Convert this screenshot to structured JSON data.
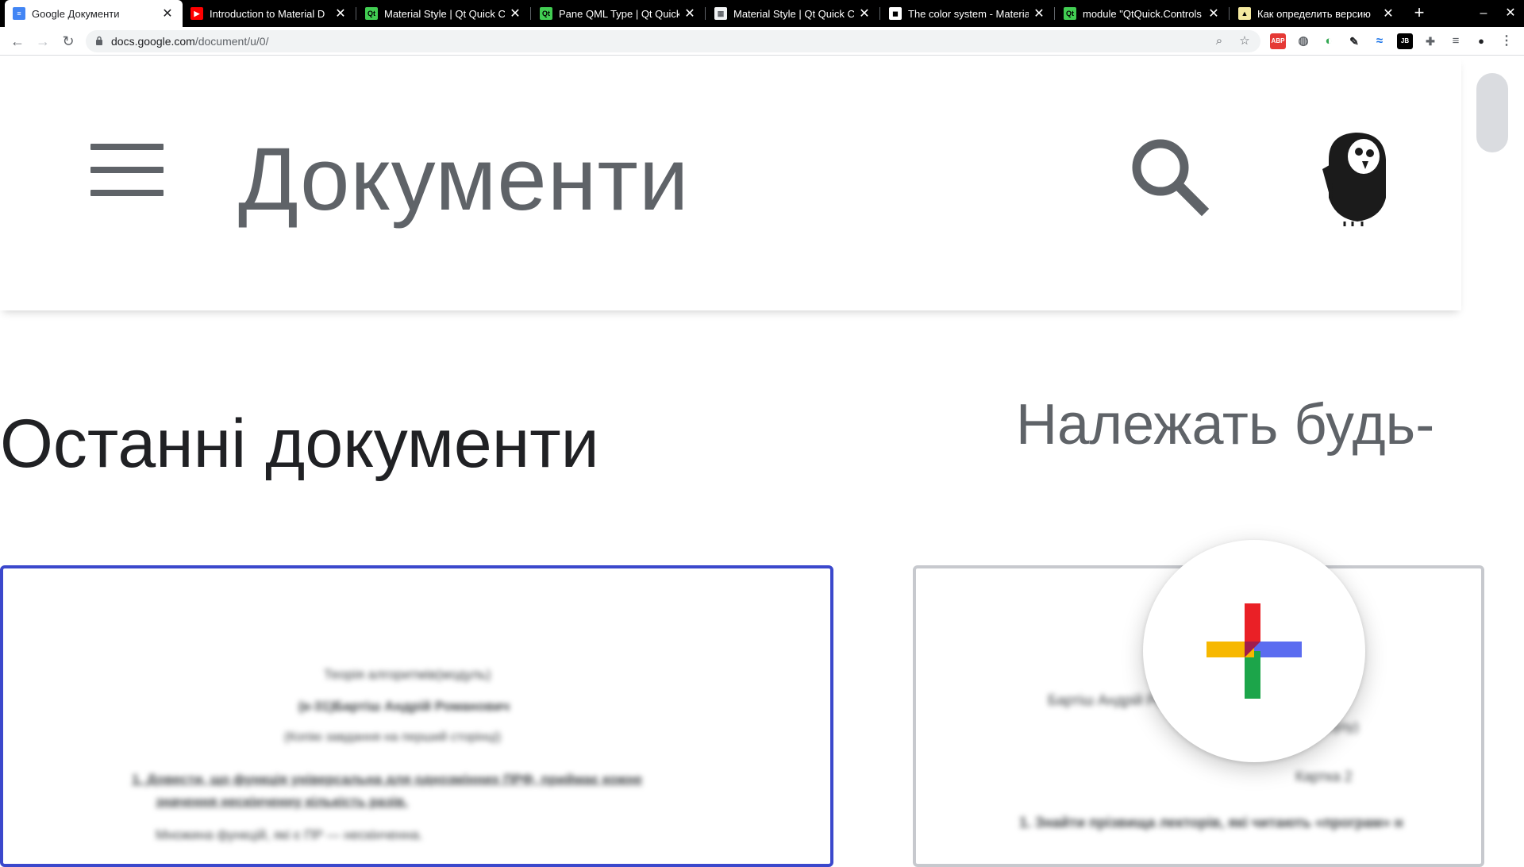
{
  "browser": {
    "tabs": [
      {
        "title": "Google Документи",
        "active": true,
        "favicon": "google-docs-icon"
      },
      {
        "title": "Introduction to Material D",
        "active": false,
        "favicon": "youtube-icon"
      },
      {
        "title": "Material Style | Qt Quick C",
        "active": false,
        "favicon": "qt-icon"
      },
      {
        "title": "Pane QML Type | Qt Quick",
        "active": false,
        "favicon": "qt-icon"
      },
      {
        "title": "Material Style | Qt Quick C",
        "active": false,
        "favicon": "page-icon"
      },
      {
        "title": "The color system - Materia",
        "active": false,
        "favicon": "material-icon"
      },
      {
        "title": "module \"QtQuick.Controls",
        "active": false,
        "favicon": "qt-icon"
      },
      {
        "title": "Как определить версию",
        "active": false,
        "favicon": "page-icon"
      }
    ],
    "new_tab_symbol": "+",
    "address": {
      "host": "docs.google.com",
      "path": "/document/u/0/"
    },
    "extensions": [
      {
        "name": "adblock-icon",
        "label": "ABP",
        "color": "#e53935"
      },
      {
        "name": "globe-icon",
        "label": "◍",
        "color": "#5f6368"
      },
      {
        "name": "chrome-ext-icon",
        "label": "◐",
        "color": "#34a853"
      },
      {
        "name": "tool-icon",
        "label": "✎",
        "color": "#202124"
      },
      {
        "name": "wave-icon",
        "label": "≈",
        "color": "#1a73e8"
      },
      {
        "name": "jb-icon",
        "label": "JB",
        "color": "#202124"
      },
      {
        "name": "puzzle-icon",
        "label": "✚",
        "color": "#5f6368"
      },
      {
        "name": "reading-list-icon",
        "label": "≡",
        "color": "#5f6368"
      },
      {
        "name": "profile-icon",
        "label": "●",
        "color": "#202124"
      }
    ]
  },
  "app": {
    "title": "Документи",
    "section_title": "Останні документи",
    "owner_filter": "Належать будь-",
    "accent": "#3b48cc"
  },
  "documents": [
    {
      "selected": true,
      "preview_lines": [
        "Теорія алгоритмів(модуль)",
        "(к-31)Бартіш Андрій Романович",
        "(Копію завдання на перший сторінці)",
        "1.  Довести, що функція універсальна для однозмінних ПРФ, приймає кожне",
        "значення нескінченну кількість разів.",
        "Множина функцій, які є ПР — нескінченна."
      ]
    },
    {
      "selected": false,
      "preview_lines": [
        "Бартіш Андрій Романович ООП(Сервісно",
        "(рівень доступу)",
        "Картка 2",
        "1. Знайти прізвища лекторів, які читають «програм» н"
      ]
    }
  ],
  "fab": {
    "colors": {
      "red": "#ea2026",
      "blue": "#5b6cf0",
      "green": "#1ca54a",
      "yellow": "#f7b800"
    }
  }
}
